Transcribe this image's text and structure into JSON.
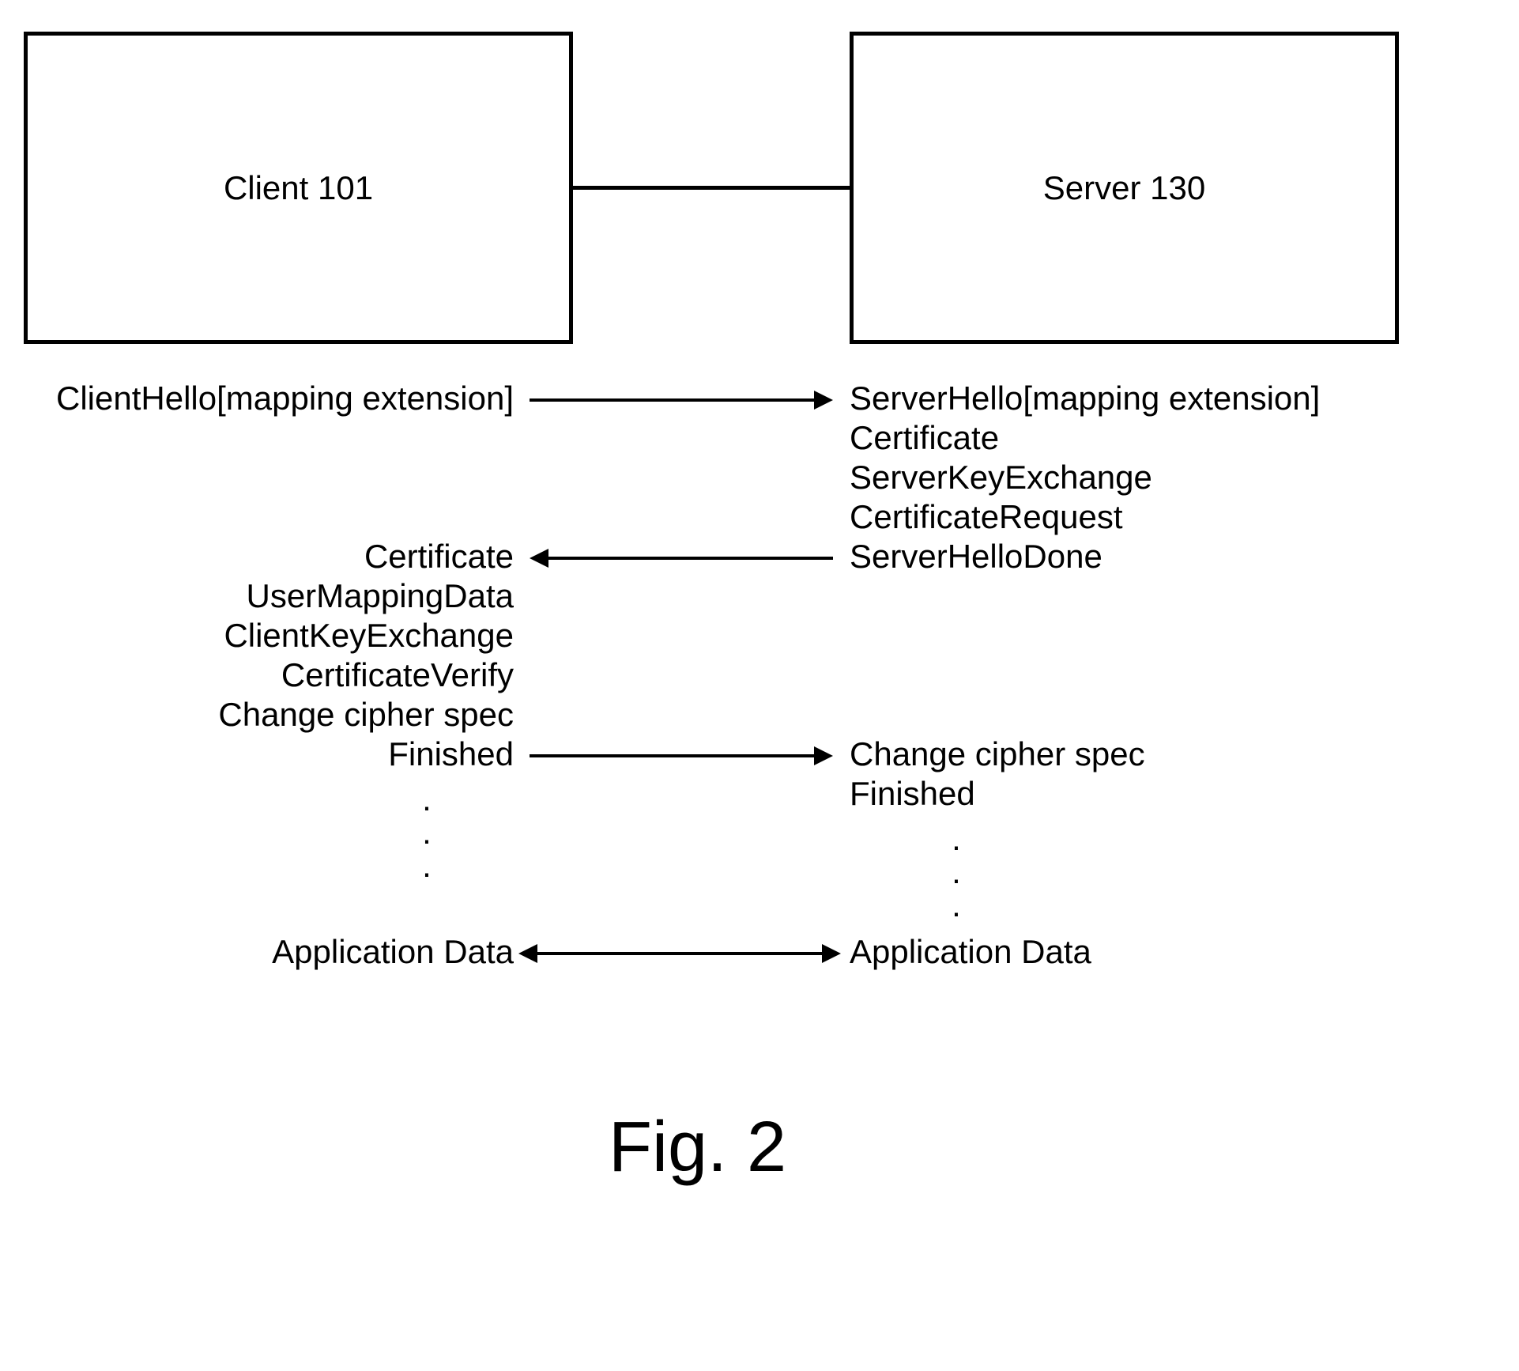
{
  "boxes": {
    "client": "Client 101",
    "server": "Server 130"
  },
  "messages": {
    "clientHello": "ClientHello[mapping extension]",
    "serverHello": "ServerHello[mapping extension]",
    "certificateServer": "Certificate",
    "serverKeyExchange": "ServerKeyExchange",
    "certificateRequest": "CertificateRequest",
    "serverHelloDone": "ServerHelloDone",
    "certificateClient": "Certificate",
    "userMappingData": "UserMappingData",
    "clientKeyExchange": "ClientKeyExchange",
    "certificateVerify": "CertificateVerify",
    "changeCipherSpecClient": "Change cipher spec",
    "finishedClient": "Finished",
    "changeCipherSpecServer": "Change cipher spec",
    "finishedServer": "Finished",
    "appDataClient": "Application Data",
    "appDataServer": "Application Data"
  },
  "caption": "Fig. 2"
}
